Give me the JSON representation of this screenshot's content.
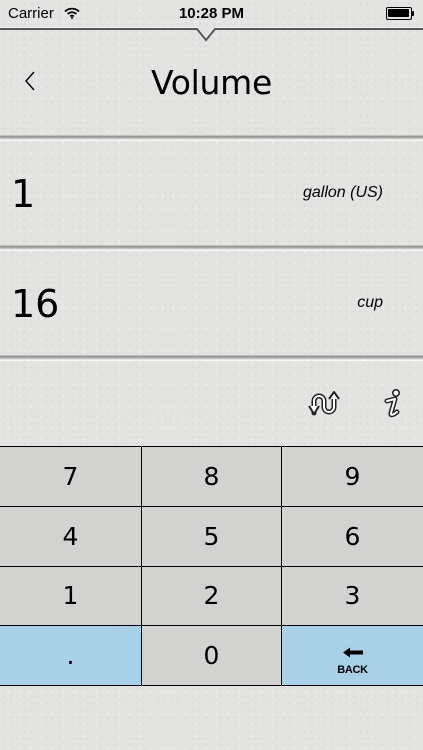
{
  "status_bar": {
    "carrier": "Carrier",
    "time": "10:28 PM",
    "battery_level": 1.0
  },
  "nav": {
    "title": "Volume",
    "back_icon": "chevron-left-icon"
  },
  "conversion": {
    "from": {
      "value": "1",
      "unit": "gallon (US)"
    },
    "to": {
      "value": "16",
      "unit": "cup"
    }
  },
  "tools": {
    "swap_icon": "swap-arrows-icon",
    "info_icon": "info-icon"
  },
  "keypad": {
    "keys": [
      "7",
      "8",
      "9",
      "4",
      "5",
      "6",
      "1",
      "2",
      "3",
      ".",
      "0"
    ],
    "backspace_label": "BACK"
  },
  "colors": {
    "background": "#e3e3e1",
    "key": "#d2d2d0",
    "key_accent": "#a8d0e7"
  }
}
